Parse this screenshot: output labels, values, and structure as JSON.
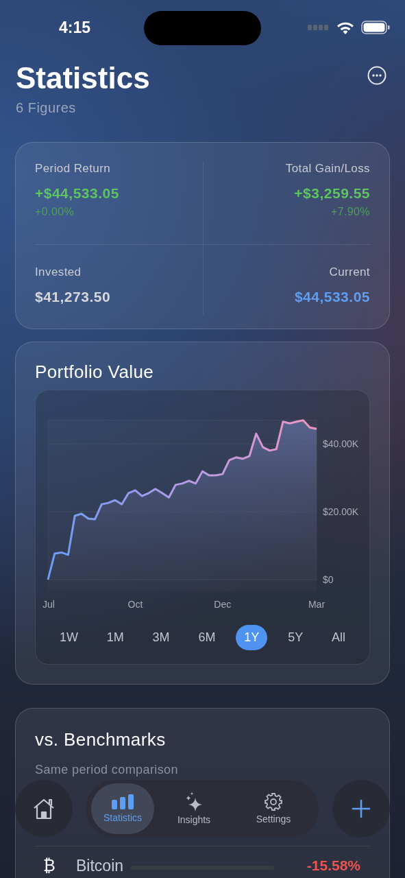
{
  "status_bar": {
    "time": "4:15"
  },
  "header": {
    "title": "Statistics",
    "subtitle": "6 Figures"
  },
  "summary": [
    {
      "label": "Period Return",
      "value": "+$44,533.05",
      "change": "+0.00%",
      "color": "#5cc461"
    },
    {
      "label": "Total Gain/Loss",
      "value": "+$3,259.55",
      "change": "+7.90%",
      "color": "#5cc461"
    },
    {
      "label": "Invested",
      "value": "$41,273.50",
      "color": "#d6d8de"
    },
    {
      "label": "Current",
      "value": "$44,533.05",
      "color": "#5d9ef2"
    }
  ],
  "portfolio": {
    "title": "Portfolio Value",
    "chart_data": {
      "type": "area",
      "categories": [
        "Jul",
        null,
        null,
        null,
        null,
        null,
        null,
        null,
        null,
        null,
        null,
        null,
        null,
        "Oct",
        null,
        null,
        null,
        null,
        null,
        null,
        null,
        null,
        null,
        null,
        null,
        null,
        "Dec",
        null,
        null,
        null,
        null,
        null,
        null,
        null,
        null,
        null,
        null,
        null,
        null,
        null,
        "Mar"
      ],
      "values": [
        0,
        7700,
        8000,
        7300,
        18800,
        19400,
        18000,
        17800,
        22200,
        22600,
        23400,
        22200,
        25500,
        26300,
        24600,
        25500,
        26700,
        25500,
        24200,
        27900,
        28300,
        29100,
        28300,
        31900,
        30700,
        30700,
        31100,
        35200,
        36000,
        35600,
        36400,
        43000,
        39000,
        38000,
        38400,
        46500,
        46000,
        46500,
        46900,
        44800,
        44400
      ],
      "yticks": [
        {
          "value": 0,
          "label": "$0"
        },
        {
          "value": 20000,
          "label": "$20.00K"
        },
        {
          "value": 40000,
          "label": "$40.00K"
        }
      ],
      "ylim": [
        0,
        47000
      ]
    },
    "ranges": [
      {
        "label": "1W",
        "selected": false
      },
      {
        "label": "1M",
        "selected": false
      },
      {
        "label": "3M",
        "selected": false
      },
      {
        "label": "6M",
        "selected": false
      },
      {
        "label": "1Y",
        "selected": true
      },
      {
        "label": "5Y",
        "selected": false
      },
      {
        "label": "All",
        "selected": false
      }
    ]
  },
  "benchmarks": {
    "title": "vs. Benchmarks",
    "subtitle": "Same period comparison",
    "rows": [
      {
        "symbol": "₿",
        "name": "Bitcoin",
        "change": "-15.58%",
        "color": "#ef5350"
      }
    ]
  },
  "tab_bar": {
    "tabs": [
      {
        "label": "Statistics",
        "kind": "chart",
        "selected": true
      },
      {
        "label": "Insights",
        "kind": "sparkle",
        "selected": false
      },
      {
        "label": "Settings",
        "kind": "gear",
        "selected": false
      }
    ]
  }
}
